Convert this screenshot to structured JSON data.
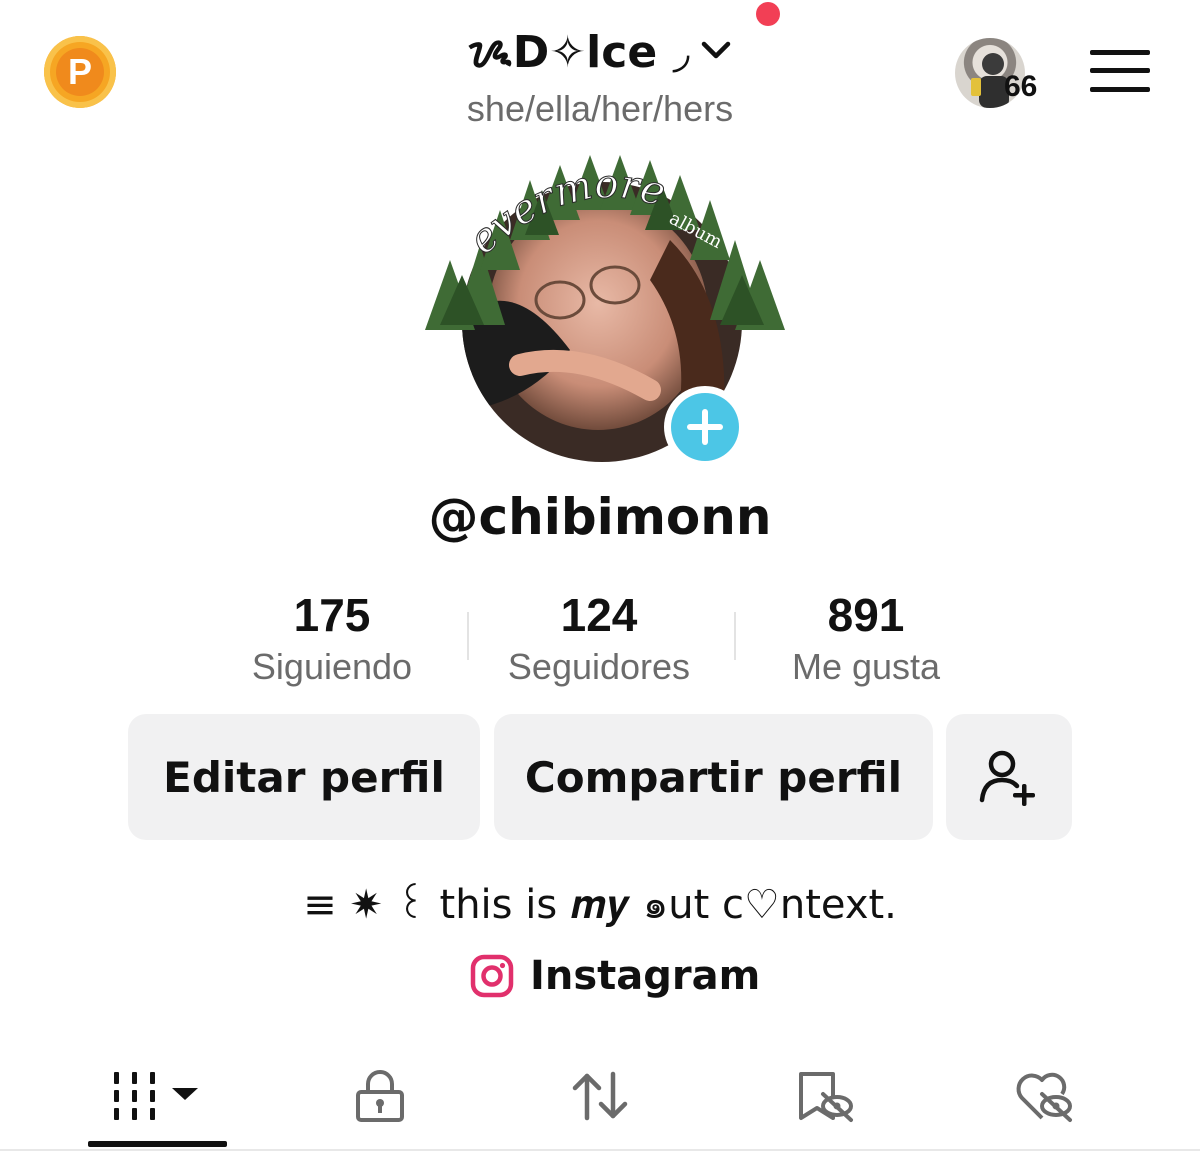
{
  "header": {
    "coin_letter": "P",
    "profile_name": "ᝰD✧lce ◞",
    "pronouns": "she/ella/her/hers",
    "friends_count": "66"
  },
  "avatar": {
    "arch_text": "evermore",
    "arch_subtext": "album"
  },
  "username": "@chibimonn",
  "stats": [
    {
      "value": "175",
      "label": "Siguiendo"
    },
    {
      "value": "124",
      "label": "Seguidores"
    },
    {
      "value": "891",
      "label": "Me gusta"
    }
  ],
  "actions": {
    "edit_label": "Editar perfil",
    "share_label": "Compartir perfil"
  },
  "bio": "≡ ✷ ꒰ this is 𝒎𝒚 ๑ut c♡ntext.",
  "link": {
    "label": "Instagram"
  },
  "tabs": [
    {
      "icon": "videos-grid-icon",
      "active": true
    },
    {
      "icon": "lock-icon",
      "active": false
    },
    {
      "icon": "repost-icon",
      "active": false
    },
    {
      "icon": "hidden-bookmark-icon",
      "active": false
    },
    {
      "icon": "hidden-likes-icon",
      "active": false
    }
  ],
  "colors": {
    "notification": "#f23f55",
    "add_avatar": "#4cc6e6",
    "coin": "#f6a623",
    "instagram": "#e1306c",
    "button_bg": "#f1f1f2"
  }
}
